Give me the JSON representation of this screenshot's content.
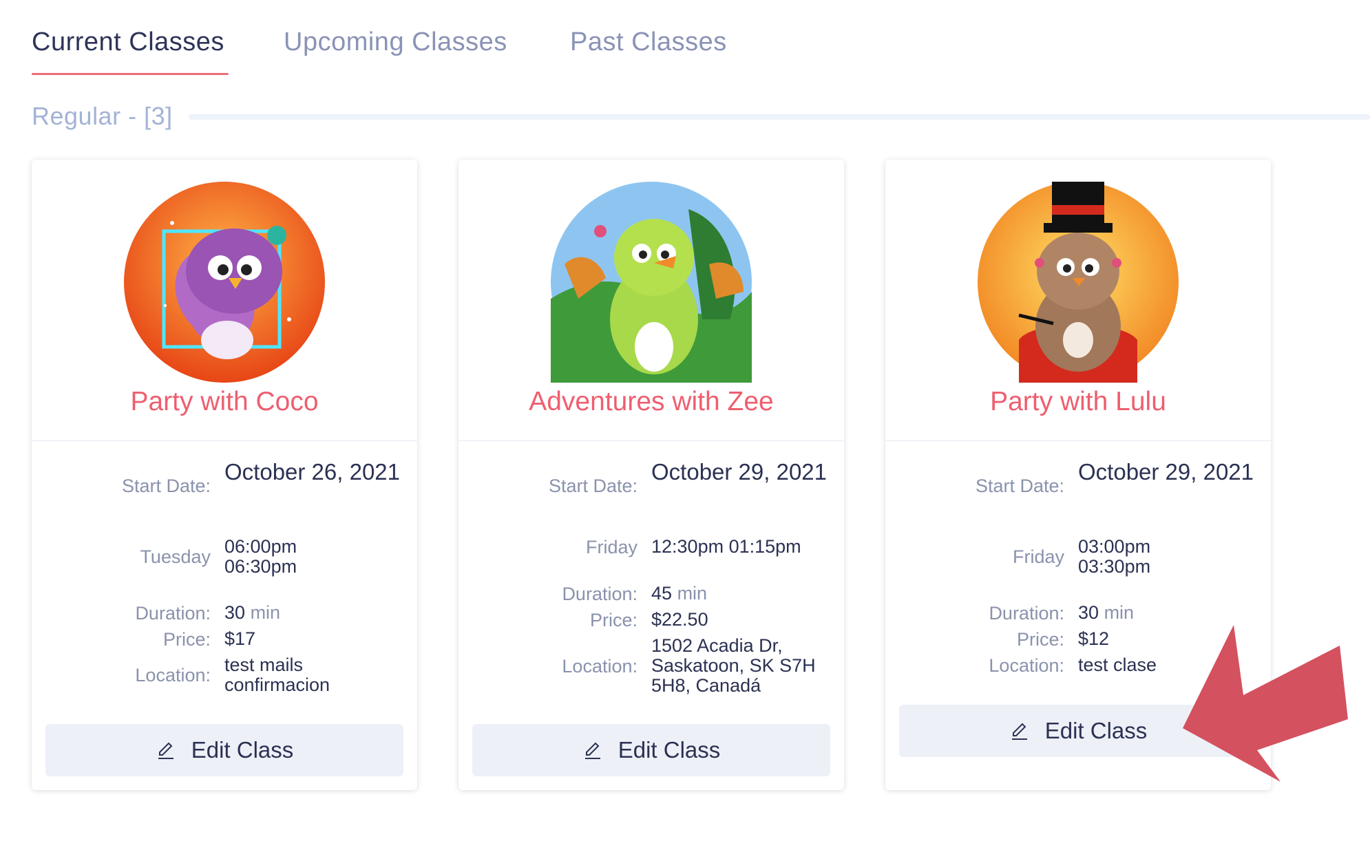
{
  "tabs": [
    {
      "label": "Current Classes",
      "active": true
    },
    {
      "label": "Upcoming Classes",
      "active": false
    },
    {
      "label": "Past Classes",
      "active": false
    }
  ],
  "section": {
    "title": "Regular - [3]"
  },
  "cards": [
    {
      "title": "Party with Coco",
      "avatar_icon": "purple-bird-party-avatar",
      "start_label": "Start Date:",
      "start_date": "October 26, 2021",
      "day": "Tuesday",
      "time_start": "06:00pm",
      "time_end": "06:30pm",
      "duration_label": "Duration:",
      "duration_value": "30",
      "duration_unit": "min",
      "price_label": "Price:",
      "price": "$17",
      "location_label": "Location:",
      "location": "test mails confirmacion",
      "button_label": "Edit Class",
      "button_icon": "pencil-edit-icon"
    },
    {
      "title": "Adventures with Zee",
      "avatar_icon": "green-bird-jungle-avatar",
      "start_label": "Start Date:",
      "start_date": "October 29, 2021",
      "day": "Friday",
      "time_start": "12:30pm",
      "time_end": "01:15pm",
      "duration_label": "Duration:",
      "duration_value": "45",
      "duration_unit": "min",
      "price_label": "Price:",
      "price": "$22.50",
      "location_label": "Location:",
      "location": "1502 Acadia Dr, Saskatoon, SK S7H 5H8, Canadá",
      "button_label": "Edit Class",
      "button_icon": "pencil-edit-icon"
    },
    {
      "title": "Party with Lulu",
      "avatar_icon": "brown-bird-top-hat-avatar",
      "start_label": "Start Date:",
      "start_date": "October 29, 2021",
      "day": "Friday",
      "time_start": "03:00pm",
      "time_end": "03:30pm",
      "duration_label": "Duration:",
      "duration_value": "30",
      "duration_unit": "min",
      "price_label": "Price:",
      "price": "$12",
      "location_label": "Location:",
      "location": "test clase",
      "button_label": "Edit Class",
      "button_icon": "pencil-edit-icon"
    }
  ],
  "annotation": {
    "icon": "red-pointer-arrow",
    "color": "#d4515f"
  },
  "colors": {
    "accent": "#f06b78",
    "card_title": "#ee5e6f",
    "tab_active": "#2e3458",
    "tab_inactive": "#8a93b5"
  }
}
